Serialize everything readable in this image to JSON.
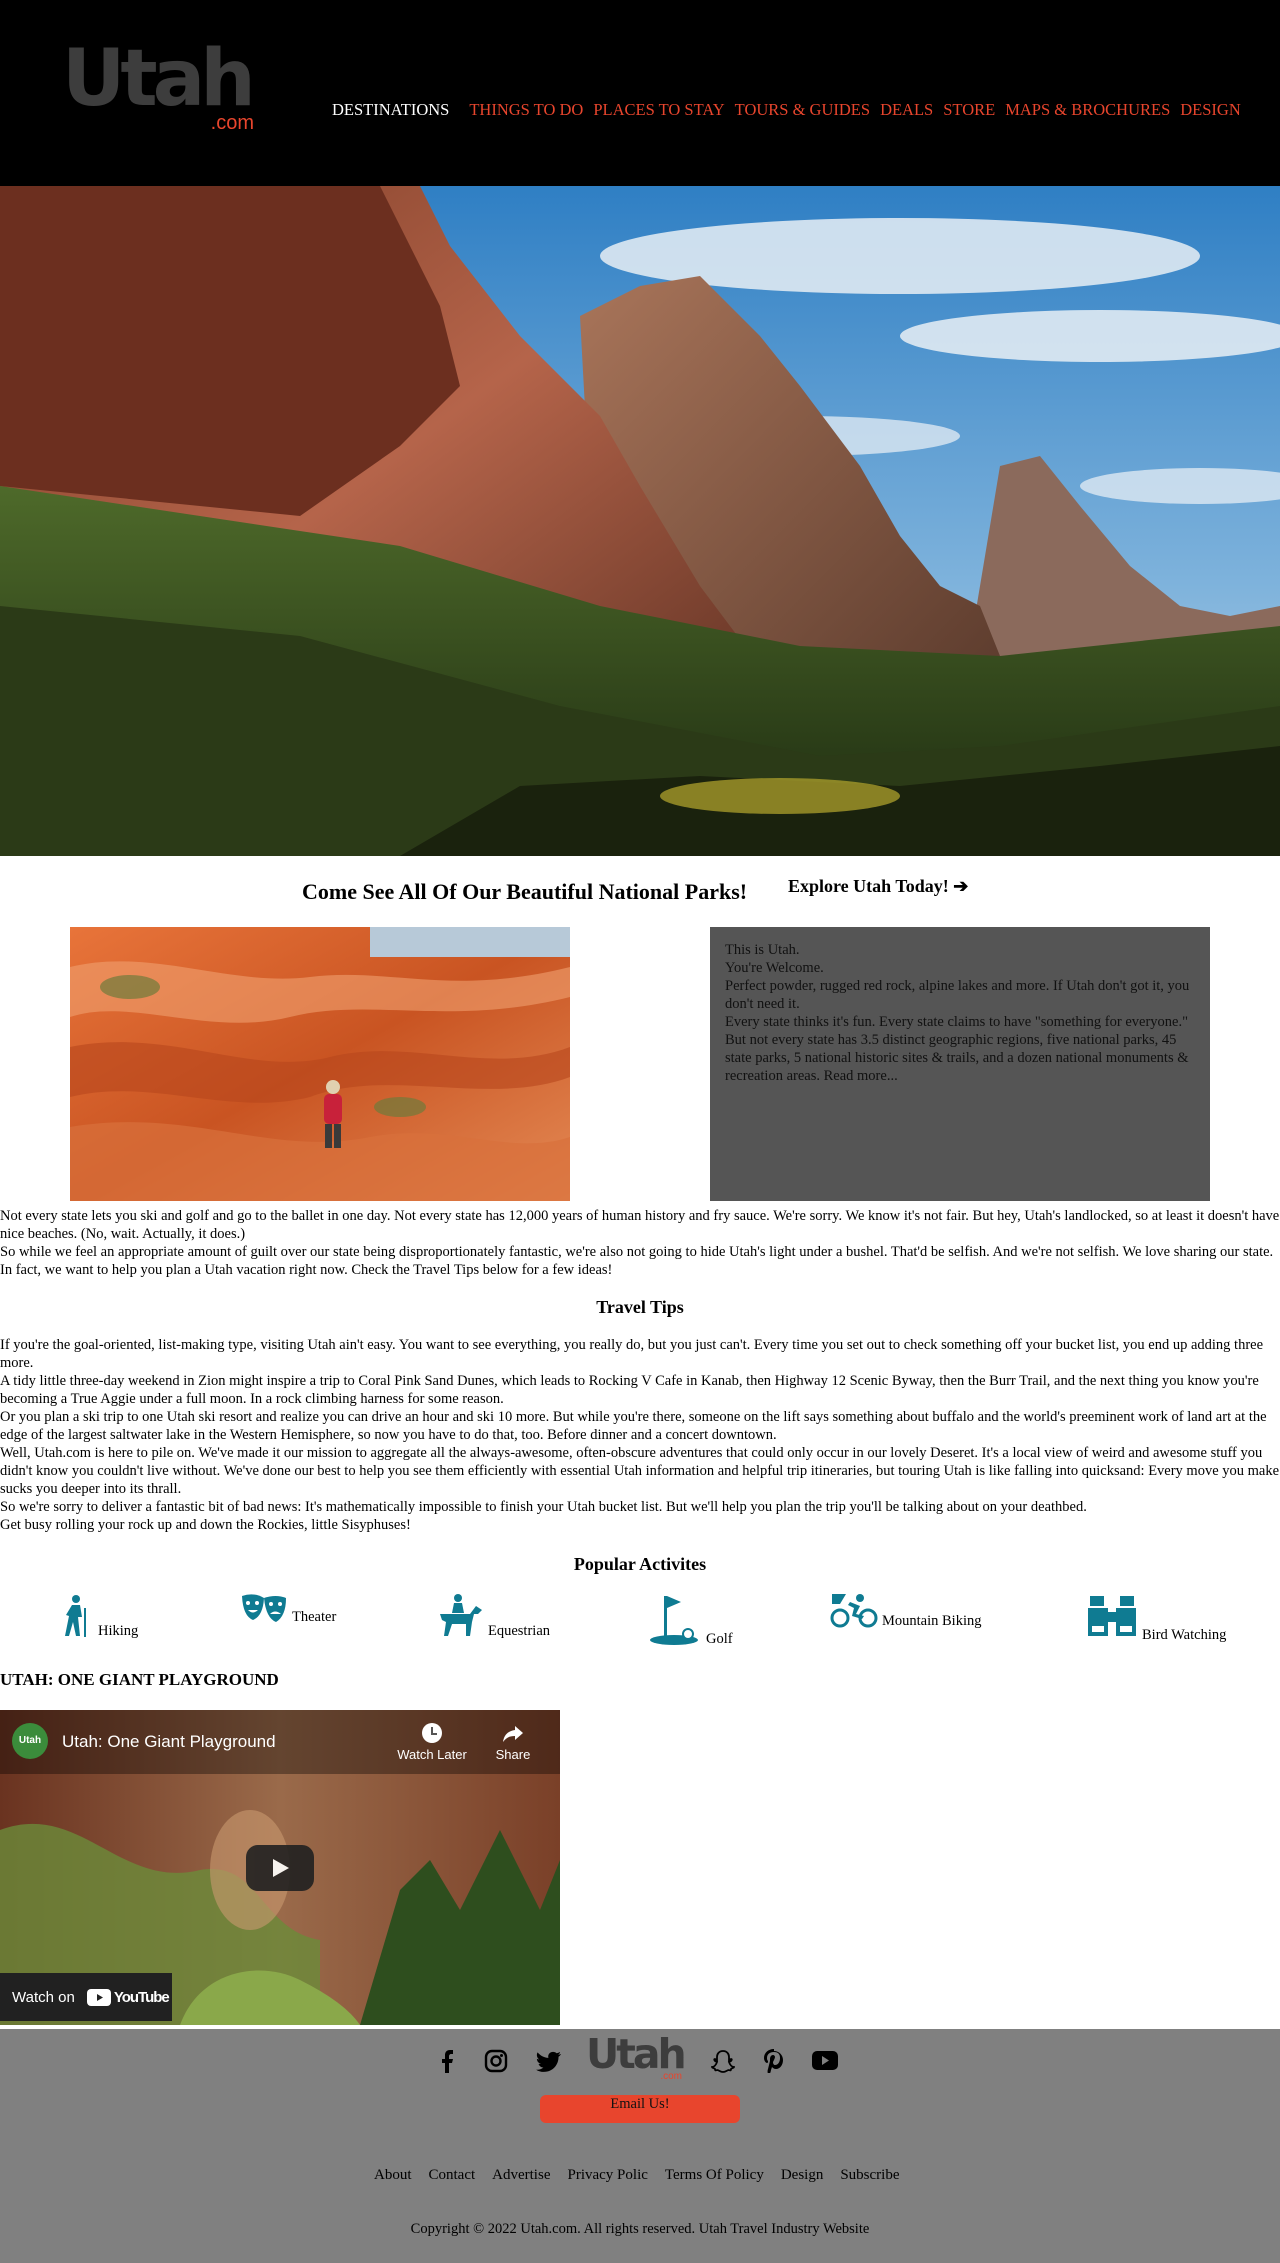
{
  "header": {
    "logo_text": "Utah",
    "logo_suffix": ".com",
    "nav": [
      "DESTINATIONS",
      "THINGS TO DO",
      "PLACES TO STAY",
      "TOURS & GUIDES",
      "DEALS",
      "STORE",
      "MAPS & BROCHURES",
      "DESIGN"
    ]
  },
  "intro": {
    "title": "Come See All Of Our Beautiful National Parks!",
    "explore": "Explore Utah Today!",
    "explore_arrow": "➔",
    "panel_lines": [
      "This is Utah.",
      "You're Welcome.",
      "Perfect powder, rugged red rock, alpine lakes and more. If Utah don't got it, you don't need it.",
      "Every state thinks it's fun. Every state claims to have \"something for everyone.\" But not every state has 3.5 distinct geographic regions, five national parks, 45 state parks, 5 national historic sites & trails, and a dozen national monuments & recreation areas. Read more..."
    ],
    "paragraphs": [
      "Not every state lets you ski and golf and go to the ballet in one day. Not every state has 12,000 years of human history and fry sauce. We're sorry. We know it's not fair. But hey, Utah's landlocked, so at least it doesn't have nice beaches. (No, wait. Actually, it does.)",
      "So while we feel an appropriate amount of guilt over our state being disproportionately fantastic, we're also not going to hide Utah's light under a bushel. That'd be selfish. And we're not selfish. We love sharing our state. In fact, we want to help you plan a Utah vacation right now. Check the Travel Tips below for a few ideas!"
    ]
  },
  "travel_tips": {
    "title": "Travel Tips",
    "paragraphs": [
      "If you're the goal-oriented, list-making type, visiting Utah ain't easy. You want to see everything, you really do, but you just can't. Every time you set out to check something off your bucket list, you end up adding three more.",
      "A tidy little three-day weekend in Zion might inspire a trip to Coral Pink Sand Dunes, which leads to Rocking V Cafe in Kanab, then Highway 12 Scenic Byway, then the Burr Trail, and the next thing you know you're becoming a True Aggie under a full moon. In a rock climbing harness for some reason.",
      "Or you plan a ski trip to one Utah ski resort and realize you can drive an hour and ski 10 more. But while you're there, someone on the lift says something about buffalo and the world's preeminent work of land art at the edge of the largest saltwater lake in the Western Hemisphere, so now you have to do that, too. Before dinner and a concert downtown.",
      "Well, Utah.com is here to pile on. We've made it our mission to aggregate all the always-awesome, often-obscure adventures that could only occur in our lovely Deseret. It's a local view of weird and awesome stuff you didn't know you couldn't live without. We've done our best to help you see them efficiently with essential Utah information and helpful trip itineraries, but touring Utah is like falling into quicksand: Every move you make sucks you deeper into its thrall.",
      "So we're sorry to deliver a fantastic bit of bad news: It's mathematically impossible to finish your Utah bucket list. But we'll help you plan the trip you'll be talking about on your deathbed.",
      "Get busy rolling your rock up and down the Rockies, little Sisyphuses!"
    ]
  },
  "activities": {
    "title": "Popular Activites",
    "items": [
      {
        "label": "Hiking",
        "icon": "hiker-icon"
      },
      {
        "label": "Theater",
        "icon": "theater-masks-icon"
      },
      {
        "label": "Equestrian",
        "icon": "horse-rider-icon"
      },
      {
        "label": "Golf",
        "icon": "golf-flag-icon"
      },
      {
        "label": "Mountain Biking",
        "icon": "mountain-bike-icon"
      },
      {
        "label": "Bird Watching",
        "icon": "binoculars-icon"
      }
    ],
    "icon_color": "#0f7b92"
  },
  "video": {
    "section_title": "UTAH: ONE GIANT PLAYGROUND",
    "title": "Utah: One Giant Playground",
    "channel_avatar": "Utah",
    "watch_later": "Watch Later",
    "share": "Share",
    "watch_on": "Watch on",
    "youtube": "YouTube"
  },
  "footer": {
    "logo_text": "Utah",
    "logo_suffix": ".com",
    "email_button": "Email Us!",
    "links": [
      "About",
      "Contact",
      "Advertise",
      "Privacy Polic",
      "Terms Of Policy",
      "Design",
      "Subscribe"
    ],
    "copyright": "Copyright © 2022 Utah.com. All rights reserved. Utah Travel Industry Website"
  },
  "colors": {
    "accent": "#e8452d",
    "header_bg": "#000000",
    "panel_bg": "#555555",
    "footer_bg": "#808080"
  }
}
